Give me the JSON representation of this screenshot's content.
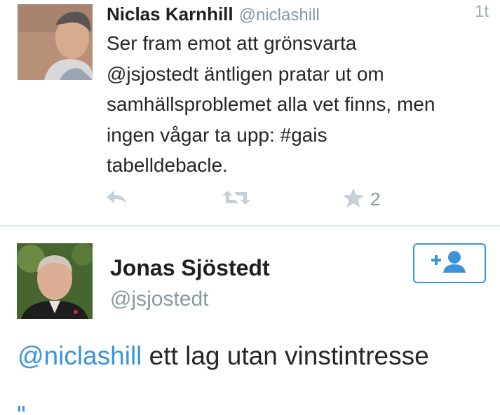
{
  "tweet": {
    "author_name": "Niclas Karnhill",
    "author_handle": "@niclashill",
    "time": "1t",
    "text": "Ser fram emot att grönsvarta\n@jsjostedt äntligen pratar ut om\nsamhällsproblemet alla vet finns, men\ningen vågar ta upp: #gais\ntabelldebacle.",
    "favorite_count": "2",
    "icons": [
      "reply-icon",
      "retweet-icon",
      "star-icon"
    ]
  },
  "profile": {
    "name": "Jonas Sjöstedt",
    "handle": "@jsjostedt",
    "follow_icon": "add-user-icon"
  },
  "reply": {
    "mention": "@niclashill",
    "text": " ett lag utan vinstintresse"
  },
  "colors": {
    "link": "#3b94d9",
    "muted": "#8899a6",
    "icon": "#c5d0d8",
    "divider": "#e1e8ed"
  }
}
